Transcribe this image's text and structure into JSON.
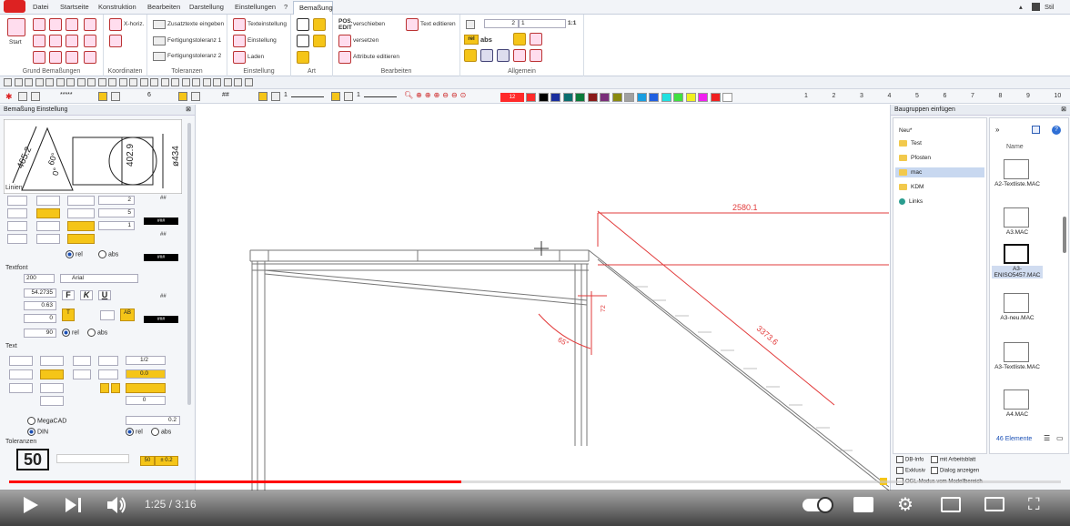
{
  "menubar": {
    "items": [
      "Datei",
      "Startseite",
      "Konstruktion",
      "Bearbeiten",
      "Darstellung",
      "Einstellungen",
      "?"
    ],
    "active_tab": "Bemaßung",
    "style_label": "Stil"
  },
  "ribbon": {
    "start_label": "Start",
    "groups": {
      "grund": "Grund Bemaßungen",
      "koordinaten": "Koordinaten",
      "toleranzen": "Toleranzen",
      "einstellung": "Einstellung",
      "art": "Art",
      "bearbeiten": "Bearbeiten",
      "allgemein": "Allgemein"
    },
    "horiz_label": "X-horiz.",
    "zusatz": "Zusatztexte eingeben",
    "fert1": "Fertigungstoleranz 1",
    "fert2": "Fertigungstoleranz 2",
    "texteinstellung": "Texteinstellung",
    "einstellung": "Einstellung",
    "laden": "Laden",
    "pos_label": "POS. EDIT",
    "verschieben": "verschieben",
    "versetzen": "versetzen",
    "attribute": "Attribute editieren",
    "text_edit": "Text editieren",
    "scale_value": "2",
    "scale_value2": "1",
    "ratio": "1:1",
    "rel": "rel",
    "abs": "abs"
  },
  "toolbar2": {
    "stars": "*****",
    "num6": "6",
    "hash": "##",
    "line1": "1",
    "line2": "1",
    "color_value": "12",
    "colors": [
      "#ff2a2a",
      "#000000",
      "#1a2f9e",
      "#0a6e6e",
      "#0a7a3a",
      "#8a1a1a",
      "#7a2f7a",
      "#8a8a10",
      "#a0a0a0",
      "#1a9ee0",
      "#2060e0",
      "#20e0e0",
      "#40e040",
      "#f0f020",
      "#f020f0",
      "#f02020",
      "#ffffff"
    ],
    "ruler": [
      "1",
      "2",
      "3",
      "4",
      "5",
      "6",
      "7",
      "8",
      "9",
      "10"
    ]
  },
  "left_panel": {
    "title": "Bemaßung Einstellung",
    "preview_dims": [
      "465.2",
      "60°",
      "0°",
      "402.9",
      "ø434"
    ],
    "sections": {
      "linien": "Linien",
      "textfont": "Textfont",
      "text": "Text",
      "toleranzen": "Toleranzen"
    },
    "linien_values": [
      "2",
      "5",
      "1"
    ],
    "hash1": "##",
    "hash2": "##",
    "hash3": "##",
    "block": "###",
    "rel": "rel",
    "abs": "abs",
    "font_size": "200",
    "font_name": "Arial",
    "text_values": [
      "54.2735",
      "0.63",
      "0",
      "90"
    ],
    "text_fields": [
      "1/2",
      "0.0",
      "0"
    ],
    "tol_value": "0.2",
    "megacad": "MegaCAD",
    "din": "DIN",
    "tol_box": "50",
    "tol_small": "50",
    "tol_pm": "± 0.2"
  },
  "canvas": {
    "dim_top": "2580.1",
    "dim_diag": "3373.6",
    "angle": "65°",
    "small_dim": "72"
  },
  "right_panel": {
    "title": "Baugruppen einfügen",
    "tree_root": "Neu*",
    "folders": [
      "Test",
      "Pfosten",
      "mac",
      "KDM",
      "Links"
    ],
    "selected_folder": "mac",
    "column_header": "Name",
    "files": [
      "A2-Textliste.MAC",
      "A3.MAC",
      "A3-ENISO5457.MAC",
      "A3-neu.MAC",
      "A3-Textliste.MAC",
      "A4.MAC"
    ],
    "selected_file": "A3-ENISO5457.MAC",
    "count": "46 Elemente",
    "checkboxes": [
      "DB-Info",
      "mit Arbeitsblatt",
      "Exklusiv",
      "Dialog anzeigen",
      "OGL-Modus vom Modellbereich"
    ]
  },
  "player": {
    "current_time": "1:25",
    "duration": "3:16",
    "time_display": "1:25 / 3:16",
    "progress": 0.43,
    "accent": "#ff0000"
  }
}
